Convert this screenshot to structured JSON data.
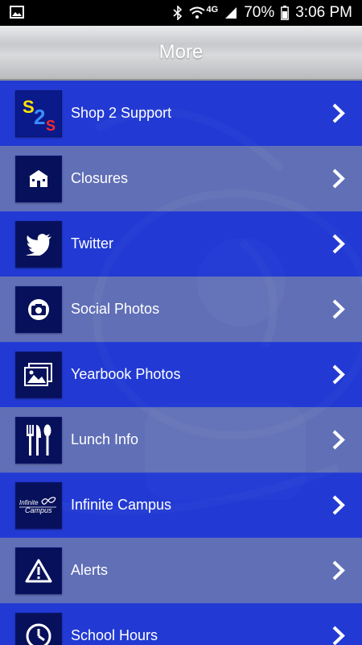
{
  "status_bar": {
    "network": "4G",
    "battery_percent": "70%",
    "time": "3:06 PM"
  },
  "header": {
    "title": "More"
  },
  "menu": {
    "items": [
      {
        "label": "Shop 2 Support",
        "icon": "shop-2-support-logo-icon"
      },
      {
        "label": "Closures",
        "icon": "school-building-icon"
      },
      {
        "label": "Twitter",
        "icon": "twitter-bird-icon"
      },
      {
        "label": "Social Photos",
        "icon": "camera-icon"
      },
      {
        "label": "Yearbook Photos",
        "icon": "photo-gallery-icon"
      },
      {
        "label": "Lunch Info",
        "icon": "fork-knife-spoon-icon"
      },
      {
        "label": "Infinite Campus",
        "icon": "infinite-campus-logo-icon",
        "logo_text": [
          "Infinite",
          "Campus"
        ]
      },
      {
        "label": "Alerts",
        "icon": "warning-triangle-icon"
      },
      {
        "label": "School Hours",
        "icon": "clock-icon"
      }
    ]
  },
  "logo_text": {
    "s2s": [
      "S",
      "2",
      "S"
    ]
  },
  "colors": {
    "blue_row": "#203ad6",
    "grey_row": "#7682b0",
    "icon_bg": "#07105a"
  }
}
